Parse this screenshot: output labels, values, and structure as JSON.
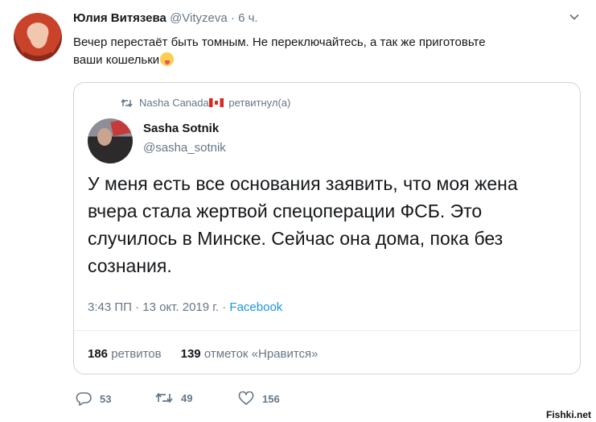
{
  "tweet": {
    "author_name": "Юлия Витязева",
    "handle": "@Vityzeva",
    "separator": " · ",
    "time": "6 ч.",
    "text_line1": "Вечер перестаёт быть томным. Не переключайтесь, а так же приготовьте",
    "text_line2": "ваши кошельки"
  },
  "quote": {
    "retweeter": "Nasha Canada",
    "retweeted_label": "ретвитнул(а)",
    "author_name": "Sasha Sotnik",
    "handle": "@sasha_sotnik",
    "text": "У меня есть все основания заявить, что моя жена вчера стала жертвой спецоперации ФСБ. Это случилось в Минске. Сейчас она дома, пока без сознания.",
    "timestamp": "3:43 ПП · 13 окт. 2019 г. · ",
    "source": "Facebook",
    "retweets_count": "186",
    "retweets_label": "ретвитов",
    "likes_count": "139",
    "likes_label": "отметок «Нравится»"
  },
  "actions": {
    "replies": "53",
    "retweets": "49",
    "likes": "156"
  },
  "watermark": "Fishki.net",
  "colors": {
    "muted": "#657786",
    "link": "#1b95e0",
    "border": "#ccd6dd"
  }
}
